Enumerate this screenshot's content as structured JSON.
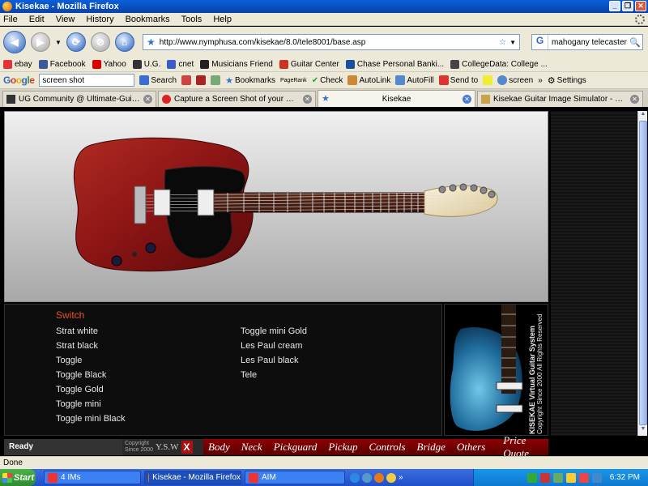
{
  "window": {
    "title": "Kisekae - Mozilla Firefox"
  },
  "menu": [
    "File",
    "Edit",
    "View",
    "History",
    "Bookmarks",
    "Tools",
    "Help"
  ],
  "nav": {
    "url": "http://www.nymphusa.com/kisekae/8.0/tele8001/base.asp",
    "search_value": "mahogany telecaster"
  },
  "bookmarks": [
    "ebay",
    "Facebook",
    "Yahoo",
    "U.G.",
    "cnet",
    "Musicians Friend",
    "Guitar Center",
    "Chase Personal Banki...",
    "CollegeData: College ..."
  ],
  "googlebar": {
    "search_value": "screen shot",
    "search_label": "Search",
    "bookmarks_label": "Bookmarks",
    "pagerank_label": "PageRank",
    "check_label": "Check",
    "autolink_label": "AutoLink",
    "autofill_label": "AutoFill",
    "sendto_label": "Send to",
    "screen_label": "screen",
    "settings_label": "Settings"
  },
  "tabs": [
    {
      "label": "UG Community @ Ultimate-Guitar.Com ..."
    },
    {
      "label": "Capture a Screen Shot of your Deskto..."
    },
    {
      "label": "Kisekae"
    },
    {
      "label": "Kisekae Guitar Image Simulator - How ..."
    }
  ],
  "parts": {
    "title": "Switch",
    "col1": [
      "Strat white",
      "Strat black",
      "Toggle",
      "Toggle Black",
      "Toggle Gold",
      "Toggle mini",
      "Toggle mini Black"
    ],
    "col2": [
      "Toggle mini Gold",
      "Les Paul cream",
      "Les Paul black",
      "Tele"
    ]
  },
  "promo": {
    "title": "KISEKAE Virtual Guitar System",
    "copyright": "Copyright Since 2000 All Rights Reserved"
  },
  "bottom": {
    "ready": "Ready",
    "copyright_line1": "Copyright",
    "copyright_line2": "Since 2000",
    "ysw": "Y.S.W",
    "menu": [
      "Body",
      "Neck",
      "Pickguard",
      "Pickup",
      "Controls",
      "Bridge",
      "Others"
    ],
    "quote": "Price Quote"
  },
  "status": {
    "text": "Done"
  },
  "taskbar": {
    "start": "Start",
    "tasks": [
      "4 IMs",
      "Kisekae - Mozilla Firefox",
      "AIM"
    ],
    "time": "6:32 PM"
  },
  "colors": {
    "accent_title": "#e6541e",
    "menu_bg": "#7a0000",
    "body_finish": "#8a1414"
  }
}
